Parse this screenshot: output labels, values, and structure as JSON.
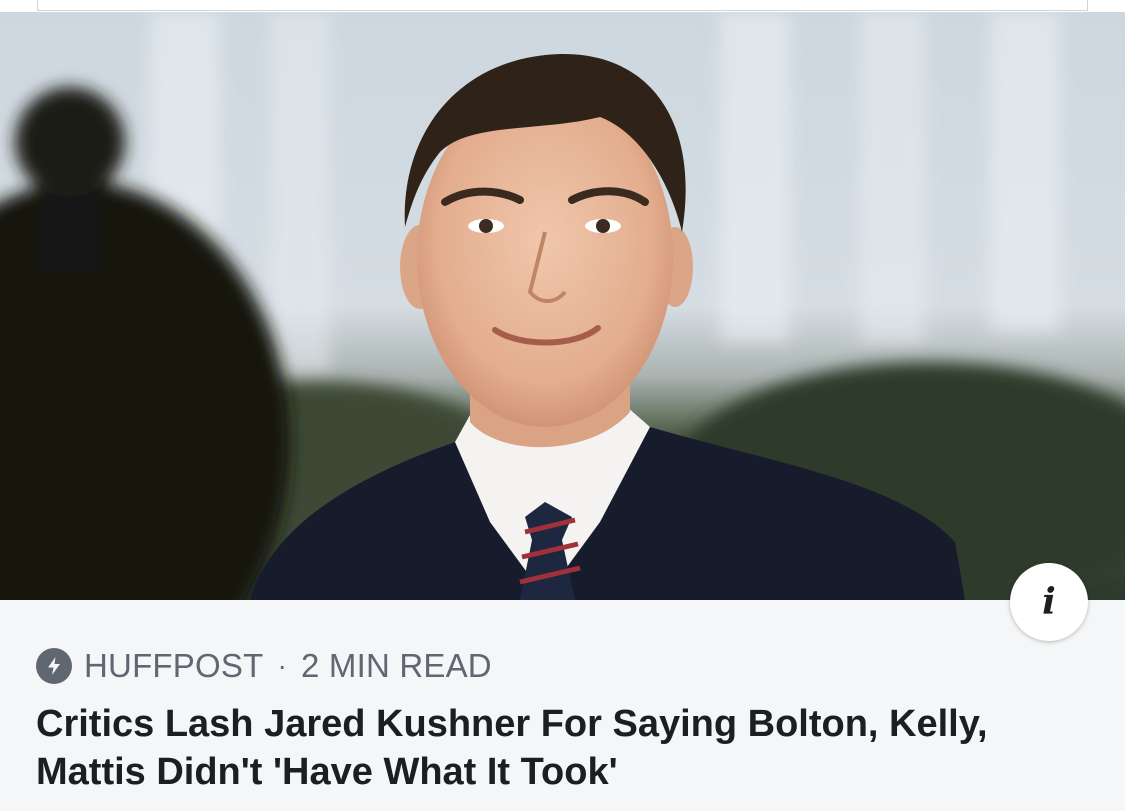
{
  "article": {
    "image": {
      "description": "photo of a smiling man in a dark suit, white shirt and striped tie, outdoors"
    },
    "info_button": {
      "icon": "info-icon",
      "label": "i"
    },
    "source": {
      "icon": "lightning-bolt-icon",
      "publisher": "HUFFPOST",
      "separator": "·",
      "read_time": "2 MIN READ"
    },
    "headline": "Critics Lash Jared Kushner For Saying Bolton, Kelly, Mattis Didn't 'Have What It Took'"
  },
  "colors": {
    "card_background": "#f5f6f7",
    "meta_text": "#606770",
    "headline_text": "#1c1e21"
  }
}
